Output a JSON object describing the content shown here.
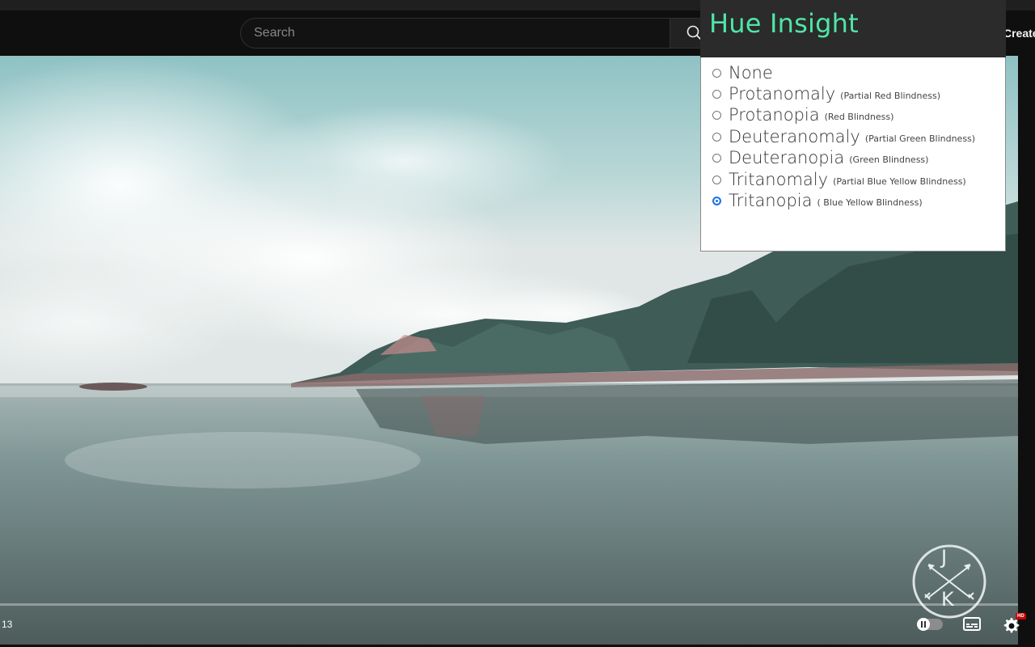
{
  "header": {
    "search_placeholder": "Search",
    "create_label": "Create"
  },
  "player": {
    "time": "13",
    "watermark_letters": [
      "J",
      "K"
    ],
    "hd_badge": "HD"
  },
  "extension": {
    "title": "Hue Insight",
    "accent_color": "#4ee6a8",
    "options": [
      {
        "label": "None",
        "sub": "",
        "checked": false
      },
      {
        "label": "Protanomaly",
        "sub": "(Partial Red Blindness)",
        "checked": false
      },
      {
        "label": "Protanopia",
        "sub": "(Red Blindness)",
        "checked": false
      },
      {
        "label": "Deuteranomaly",
        "sub": "(Partial Green Blindness)",
        "checked": false
      },
      {
        "label": "Deuteranopia",
        "sub": "(Green Blindness)",
        "checked": false
      },
      {
        "label": "Tritanomaly",
        "sub": "(Partial Blue Yellow Blindness)",
        "checked": false
      },
      {
        "label": "Tritanopia",
        "sub": "( Blue Yellow Blindness)",
        "checked": true
      }
    ]
  }
}
